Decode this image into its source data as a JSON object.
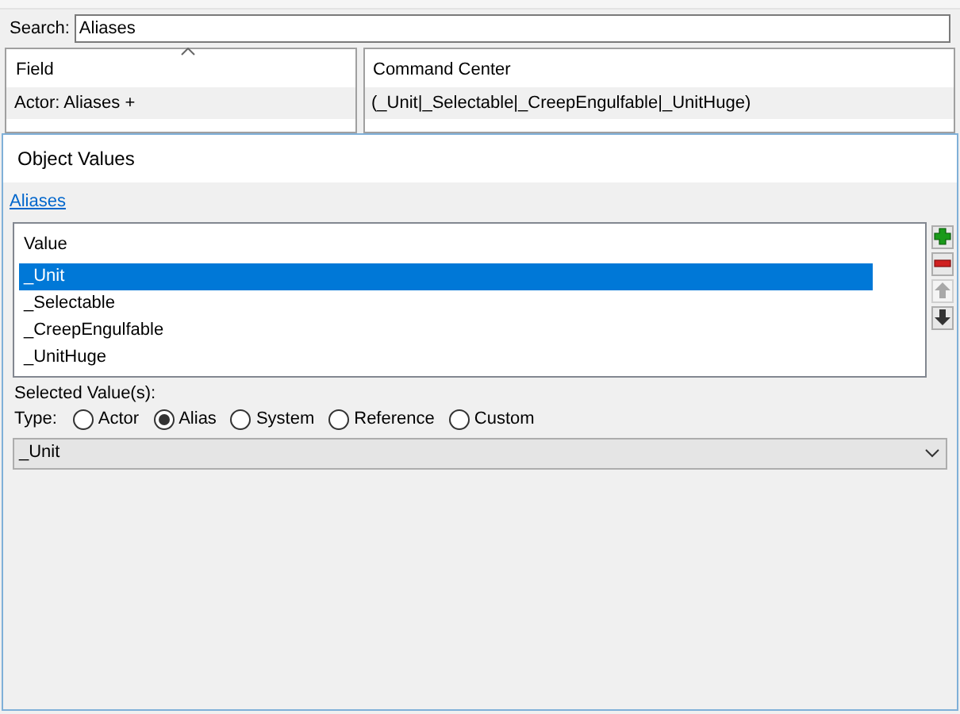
{
  "search": {
    "label": "Search:",
    "value": "Aliases"
  },
  "fields_table": {
    "column": "Field",
    "sorted": true,
    "rows": [
      {
        "field": "Actor: Aliases +"
      }
    ]
  },
  "values_table": {
    "column": "Command Center",
    "rows": [
      {
        "value": "(_Unit|_Selectable|_CreepEngulfable|_UnitHuge)"
      }
    ]
  },
  "dialog": {
    "title": "Object Values",
    "link": "Aliases",
    "list_header": "Value",
    "items": [
      {
        "label": "_Unit",
        "selected": true
      },
      {
        "label": "_Selectable",
        "selected": false
      },
      {
        "label": "_CreepEngulfable",
        "selected": false
      },
      {
        "label": "_UnitHuge",
        "selected": false
      }
    ],
    "side_buttons": [
      {
        "kind": "add",
        "disabled": false
      },
      {
        "kind": "remove",
        "disabled": false
      },
      {
        "kind": "up",
        "disabled": true
      },
      {
        "kind": "down",
        "disabled": false
      }
    ],
    "selected_label": "Selected Value(s):",
    "type_label": "Type:",
    "types": [
      {
        "label": "Actor",
        "selected": false
      },
      {
        "label": "Alias",
        "selected": true
      },
      {
        "label": "System",
        "selected": false
      },
      {
        "label": "Reference",
        "selected": false
      },
      {
        "label": "Custom",
        "selected": false
      }
    ],
    "dropdown": {
      "value": "_Unit"
    }
  }
}
